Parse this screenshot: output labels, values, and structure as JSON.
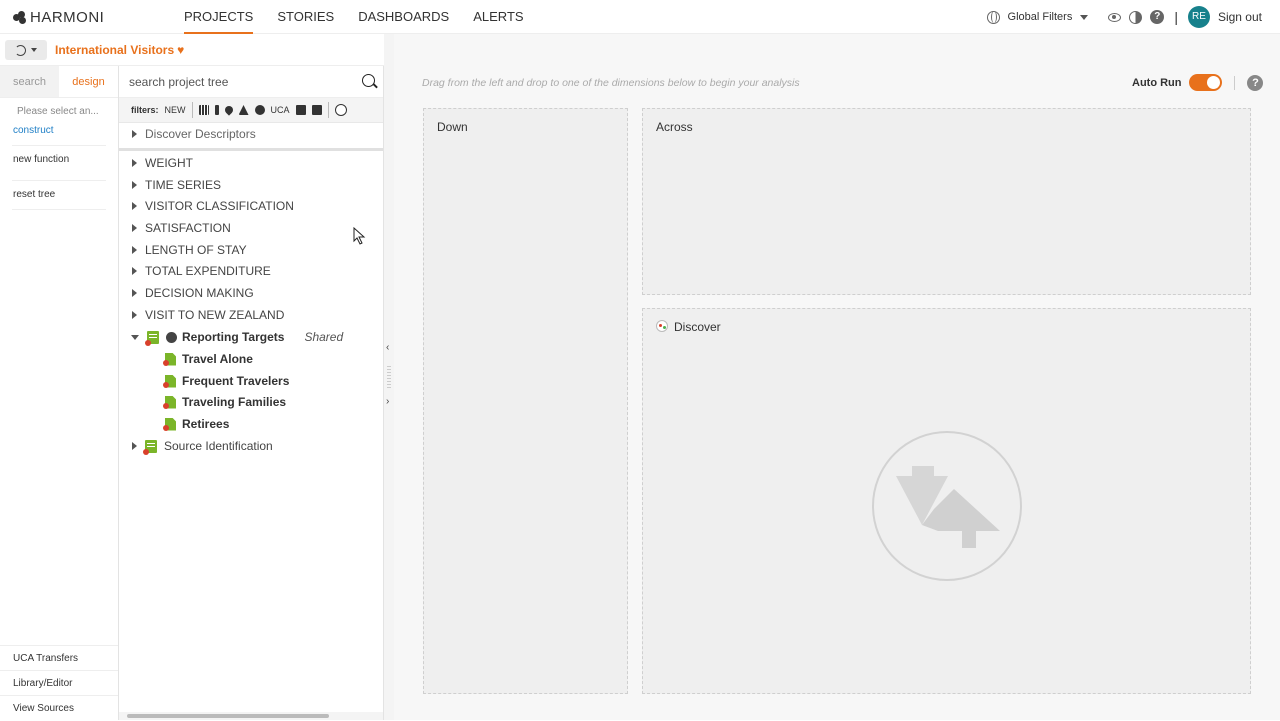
{
  "app": {
    "logo": "HARMONI"
  },
  "nav": {
    "tabs": [
      "PROJECTS",
      "STORIES",
      "DASHBOARDS",
      "ALERTS"
    ],
    "active_index": 0
  },
  "topright": {
    "global_filters": "Global Filters",
    "separator": "|",
    "avatar": "RE",
    "signout": "Sign out"
  },
  "project": {
    "title": "International Visitors"
  },
  "left": {
    "tabs": [
      "search",
      "design"
    ],
    "active_tab": "design",
    "select_placeholder": "Please select an...",
    "links": [
      "construct",
      "new function",
      "reset tree"
    ],
    "bottom": [
      "UCA Transfers",
      "Library/Editor",
      "View Sources"
    ]
  },
  "tree": {
    "search_placeholder": "search project tree",
    "filters_label": "filters:",
    "filters_new": "NEW",
    "filters_uca": "UCA",
    "top_node": "Discover Descriptors",
    "nodes": [
      "WEIGHT",
      "TIME SERIES",
      "VISITOR CLASSIFICATION",
      "SATISFACTION",
      "LENGTH OF STAY",
      "TOTAL EXPENDITURE",
      "DECISION MAKING",
      "VISIT TO NEW ZEALAND"
    ],
    "reporting": {
      "label": "Reporting Targets",
      "shared": "Shared",
      "children": [
        "Travel Alone",
        "Frequent Travelers",
        "Traveling Families",
        "Retirees"
      ]
    },
    "source": "Source Identification"
  },
  "main": {
    "hint": "Drag from the left and drop to one of the dimensions below to begin your analysis",
    "autorun_label": "Auto Run",
    "autorun_on": true,
    "help": "?",
    "zones": {
      "down": "Down",
      "across": "Across",
      "discover": "Discover"
    }
  },
  "colors": {
    "accent": "#e8711c",
    "green": "#7bb529",
    "red": "#d9402b",
    "avatar": "#17818c"
  }
}
